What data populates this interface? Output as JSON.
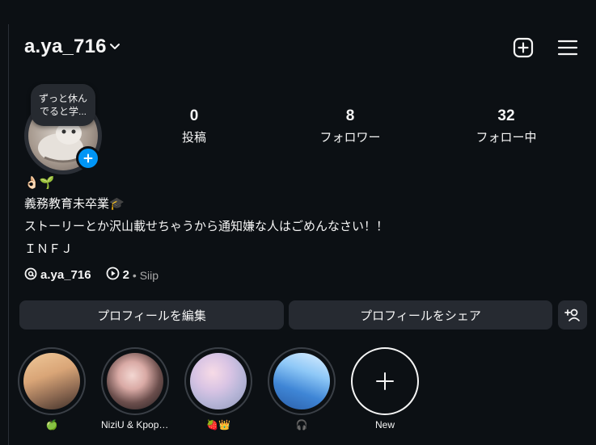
{
  "header": {
    "username": "a.ya_716",
    "new_post_icon": "plus-square-icon",
    "menu_icon": "hamburger-menu-icon"
  },
  "profile": {
    "note": [
      "ずっと休ん",
      "でると学..."
    ],
    "stats": [
      {
        "count": "0",
        "label": "投稿"
      },
      {
        "count": "8",
        "label": "フォロワー"
      },
      {
        "count": "32",
        "label": "フォロー中"
      }
    ],
    "bio": {
      "line1": "👌🏻🌱",
      "line2": "義務教育未卒業🎓",
      "line3": "ストーリーとか沢山載せちゃうから通知嫌な人はごめんなさい！！",
      "line4": "ＩＮＦＪ"
    },
    "threads_handle": "a.ya_716",
    "music_count": "2",
    "music_label": "• Siip"
  },
  "buttons": {
    "edit_profile": "プロフィールを編集",
    "share_profile": "プロフィールをシェア"
  },
  "highlights": [
    {
      "caption": "🍏"
    },
    {
      "caption": "NiziU & Kpop ..."
    },
    {
      "caption": "🍓👑"
    },
    {
      "caption": "🎧"
    },
    {
      "caption": "New"
    }
  ],
  "colors": {
    "background": "#0c1014",
    "accent_blue": "#0095f6",
    "button_bg": "#262a31"
  }
}
